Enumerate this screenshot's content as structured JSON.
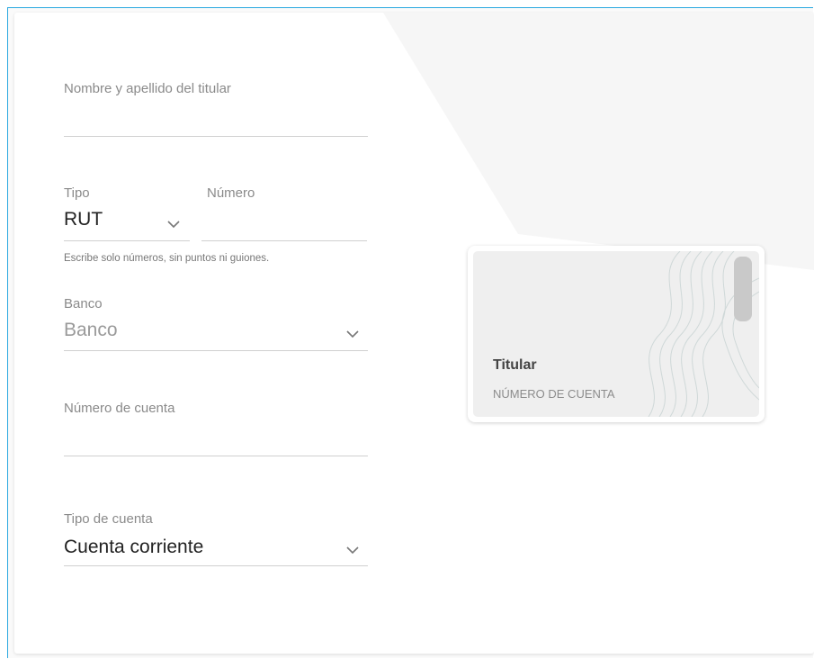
{
  "form": {
    "holder_name": {
      "label": "Nombre y apellido del titular",
      "value": ""
    },
    "id_type": {
      "label": "Tipo",
      "value": "RUT"
    },
    "id_number": {
      "label": "Número",
      "value": ""
    },
    "id_hint": "Escribe solo números, sin puntos ni guiones.",
    "bank": {
      "label": "Banco",
      "value": "Banco"
    },
    "account_number": {
      "label": "Número de cuenta",
      "value": ""
    },
    "account_type": {
      "label": "Tipo de cuenta",
      "value": "Cuenta corriente"
    }
  },
  "card_preview": {
    "holder": "Titular",
    "number": "NÚMERO DE CUENTA"
  },
  "colors": {
    "frame_border": "#29a8e0",
    "text_dark": "#222222",
    "text_muted": "#8a8a8a"
  },
  "icons": [
    "chevron-down-icon",
    "guilloche-pattern"
  ]
}
